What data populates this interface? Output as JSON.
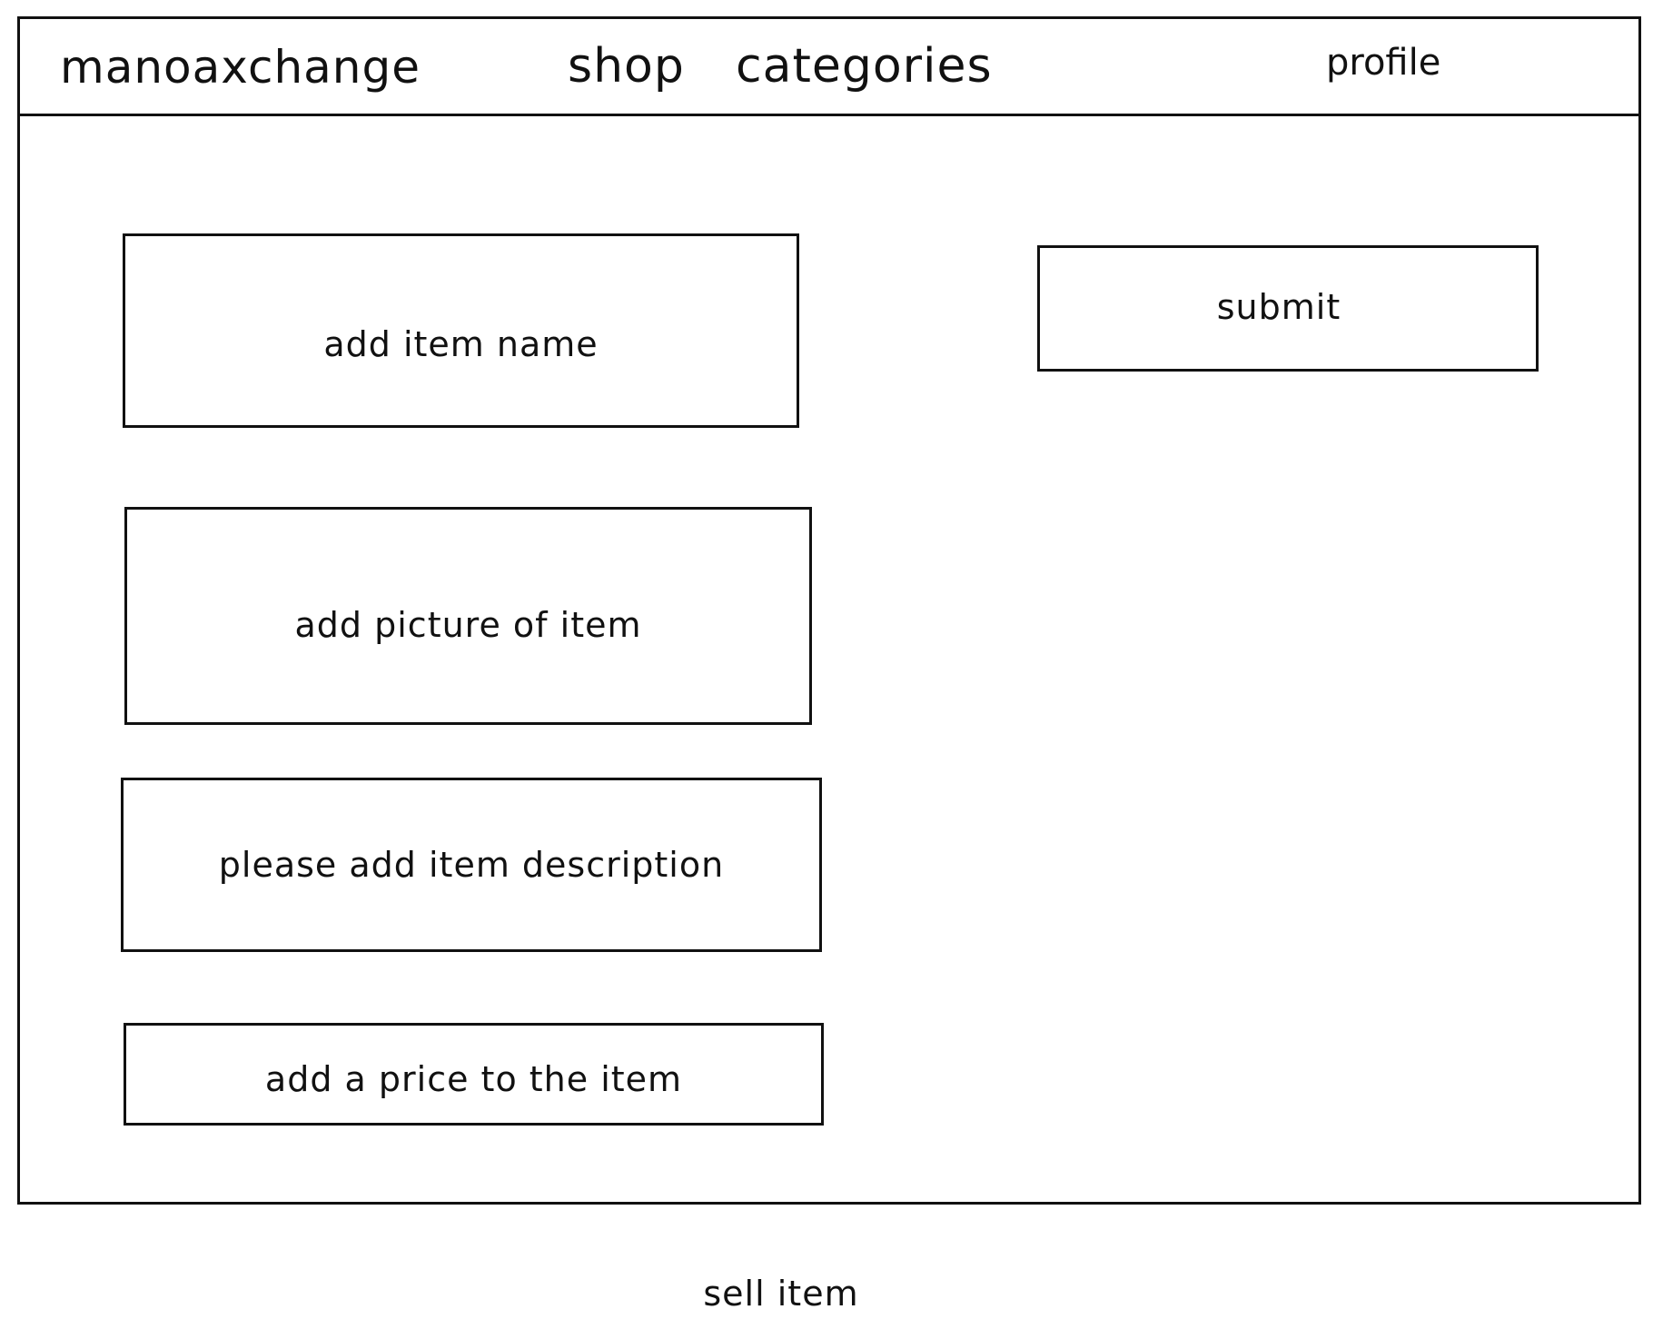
{
  "navbar": {
    "brand": "manoaxchange",
    "links": {
      "shop": "shop",
      "categories": "categories",
      "profile": "profile"
    }
  },
  "form": {
    "item_name": {
      "placeholder": "add item name"
    },
    "picture": {
      "placeholder": "add picture of item"
    },
    "description": {
      "placeholder": "please add item description"
    },
    "price": {
      "placeholder": "add a price to the item"
    },
    "submit_label": "submit"
  },
  "caption": "sell item",
  "colors": {
    "ink": "#111111",
    "background": "#ffffff"
  }
}
